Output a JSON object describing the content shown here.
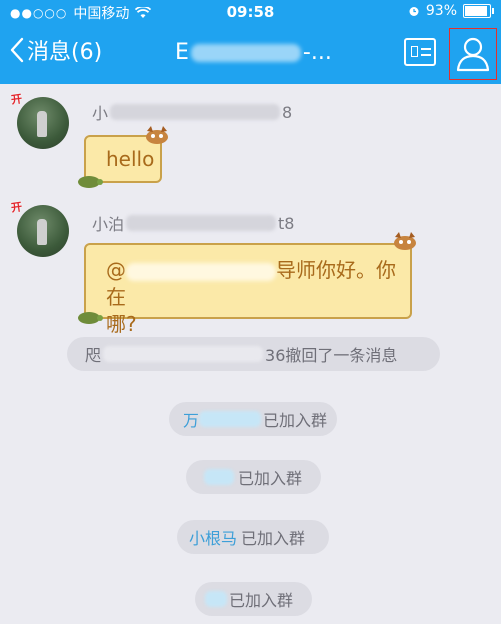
{
  "status_bar": {
    "signal_dots": "●●○○○",
    "carrier": "中国移动",
    "time": "09:58",
    "battery": "93%",
    "battery_level_percent": 93
  },
  "nav": {
    "back_label": "消息(6)",
    "title_prefix": "E",
    "title_suffix": "-..."
  },
  "messages": [
    {
      "sender_prefix": "小",
      "sender_suffix": "8",
      "text": "hello",
      "avatar_badge": "开"
    },
    {
      "sender_prefix": "小泊",
      "sender_suffix": "t8",
      "text_prefix": "@",
      "text_mid": "导师你好。你在",
      "text_line2": "哪?",
      "avatar_badge": "开"
    }
  ],
  "system": {
    "recall": {
      "prefix": "咫",
      "suffix": "36撤回了一条消息"
    },
    "joins": [
      {
        "name_visible": "万",
        "suffix": "已加入群"
      },
      {
        "name_visible": "",
        "suffix": "已加入群"
      },
      {
        "name_visible": "小根马",
        "suffix": "已加入群"
      },
      {
        "name_visible": "",
        "suffix": "已加入群"
      }
    ]
  },
  "colors": {
    "brand_blue": "#1fa3f0",
    "background": "#ebebf1",
    "bubble_fill": "#fbe9a8",
    "bubble_text": "#a86a1b",
    "highlight_red": "#e3312d"
  }
}
